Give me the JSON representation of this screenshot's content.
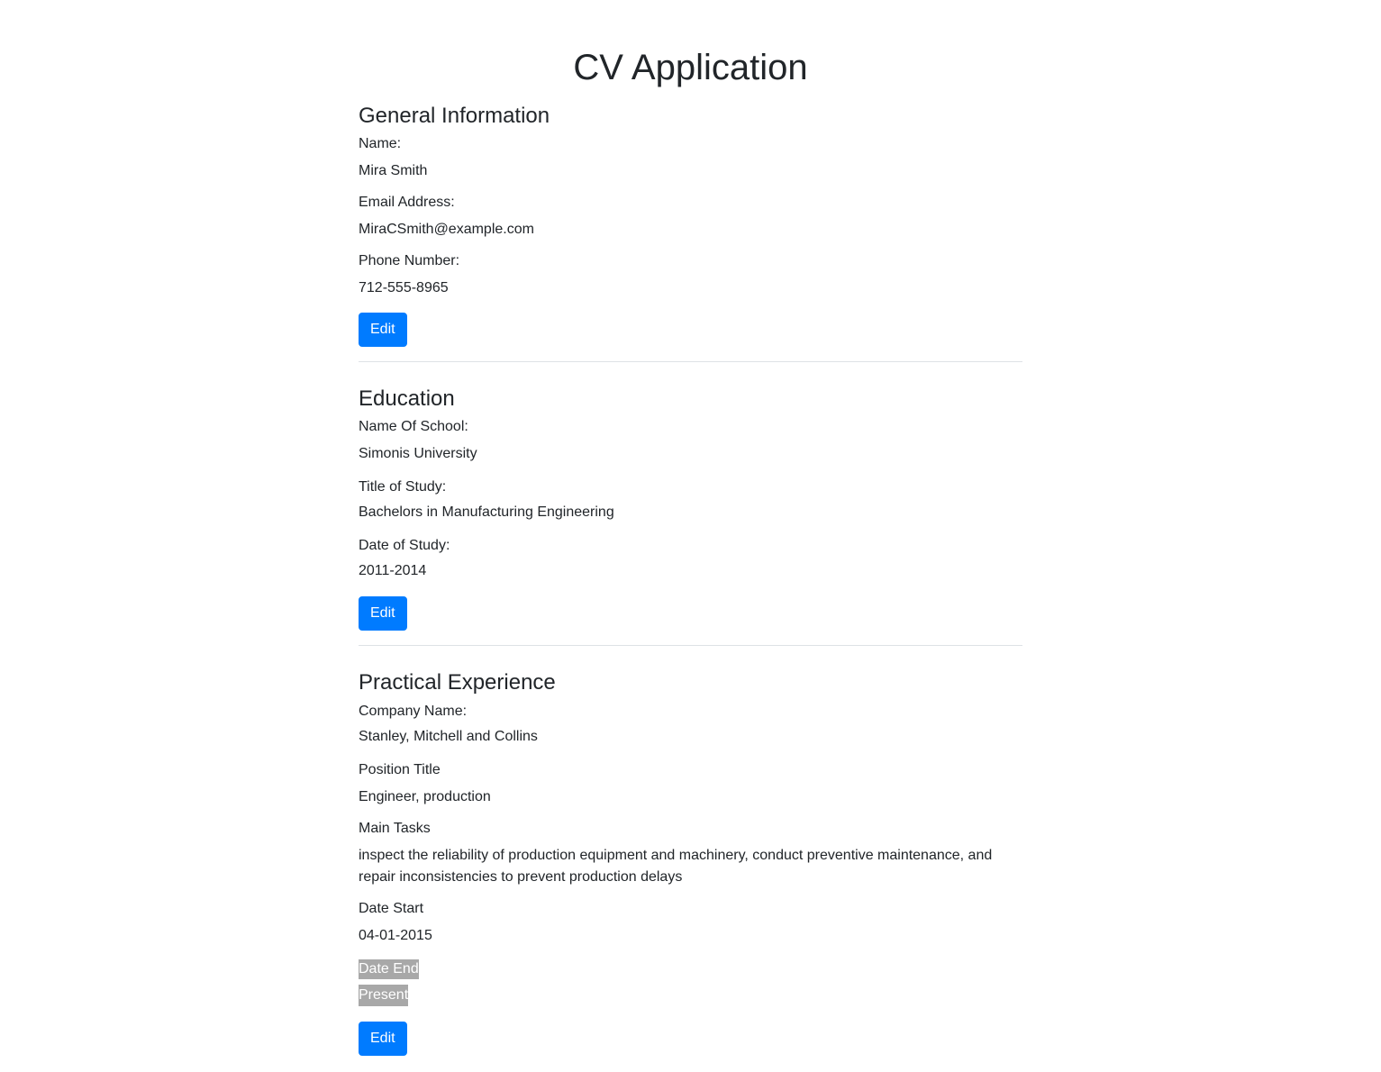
{
  "app": {
    "title": "CV Application"
  },
  "general": {
    "heading": "General Information",
    "name_label": "Name:",
    "name_value": "Mira Smith",
    "email_label": "Email Address:",
    "email_value": "MiraCSmith@example.com",
    "phone_label": "Phone Number:",
    "phone_value": "712-555-8965",
    "edit_label": "Edit"
  },
  "education": {
    "heading": "Education",
    "school_label": "Name Of School:",
    "school_value": "Simonis University",
    "title_label": "Title of Study:",
    "title_value": "Bachelors in Manufacturing Engineering",
    "date_label": "Date of Study:",
    "date_value": "2011-2014",
    "edit_label": "Edit"
  },
  "experience": {
    "heading": "Practical Experience",
    "company_label": "Company Name:",
    "company_value": "Stanley, Mitchell and Collins",
    "position_label": "Position Title",
    "position_value": "Engineer, production",
    "tasks_label": "Main Tasks",
    "tasks_value": "inspect the reliability of production equipment and machinery, conduct preventive maintenance, and repair inconsistencies to prevent production delays",
    "start_label": "Date Start",
    "start_value": "04-01-2015",
    "end_label": "Date End",
    "end_value": "Present",
    "edit_label": "Edit"
  },
  "colors": {
    "primary": "#007bff",
    "text": "#212529",
    "divider": "#dee2e6",
    "selection": "#a8a8a8"
  }
}
